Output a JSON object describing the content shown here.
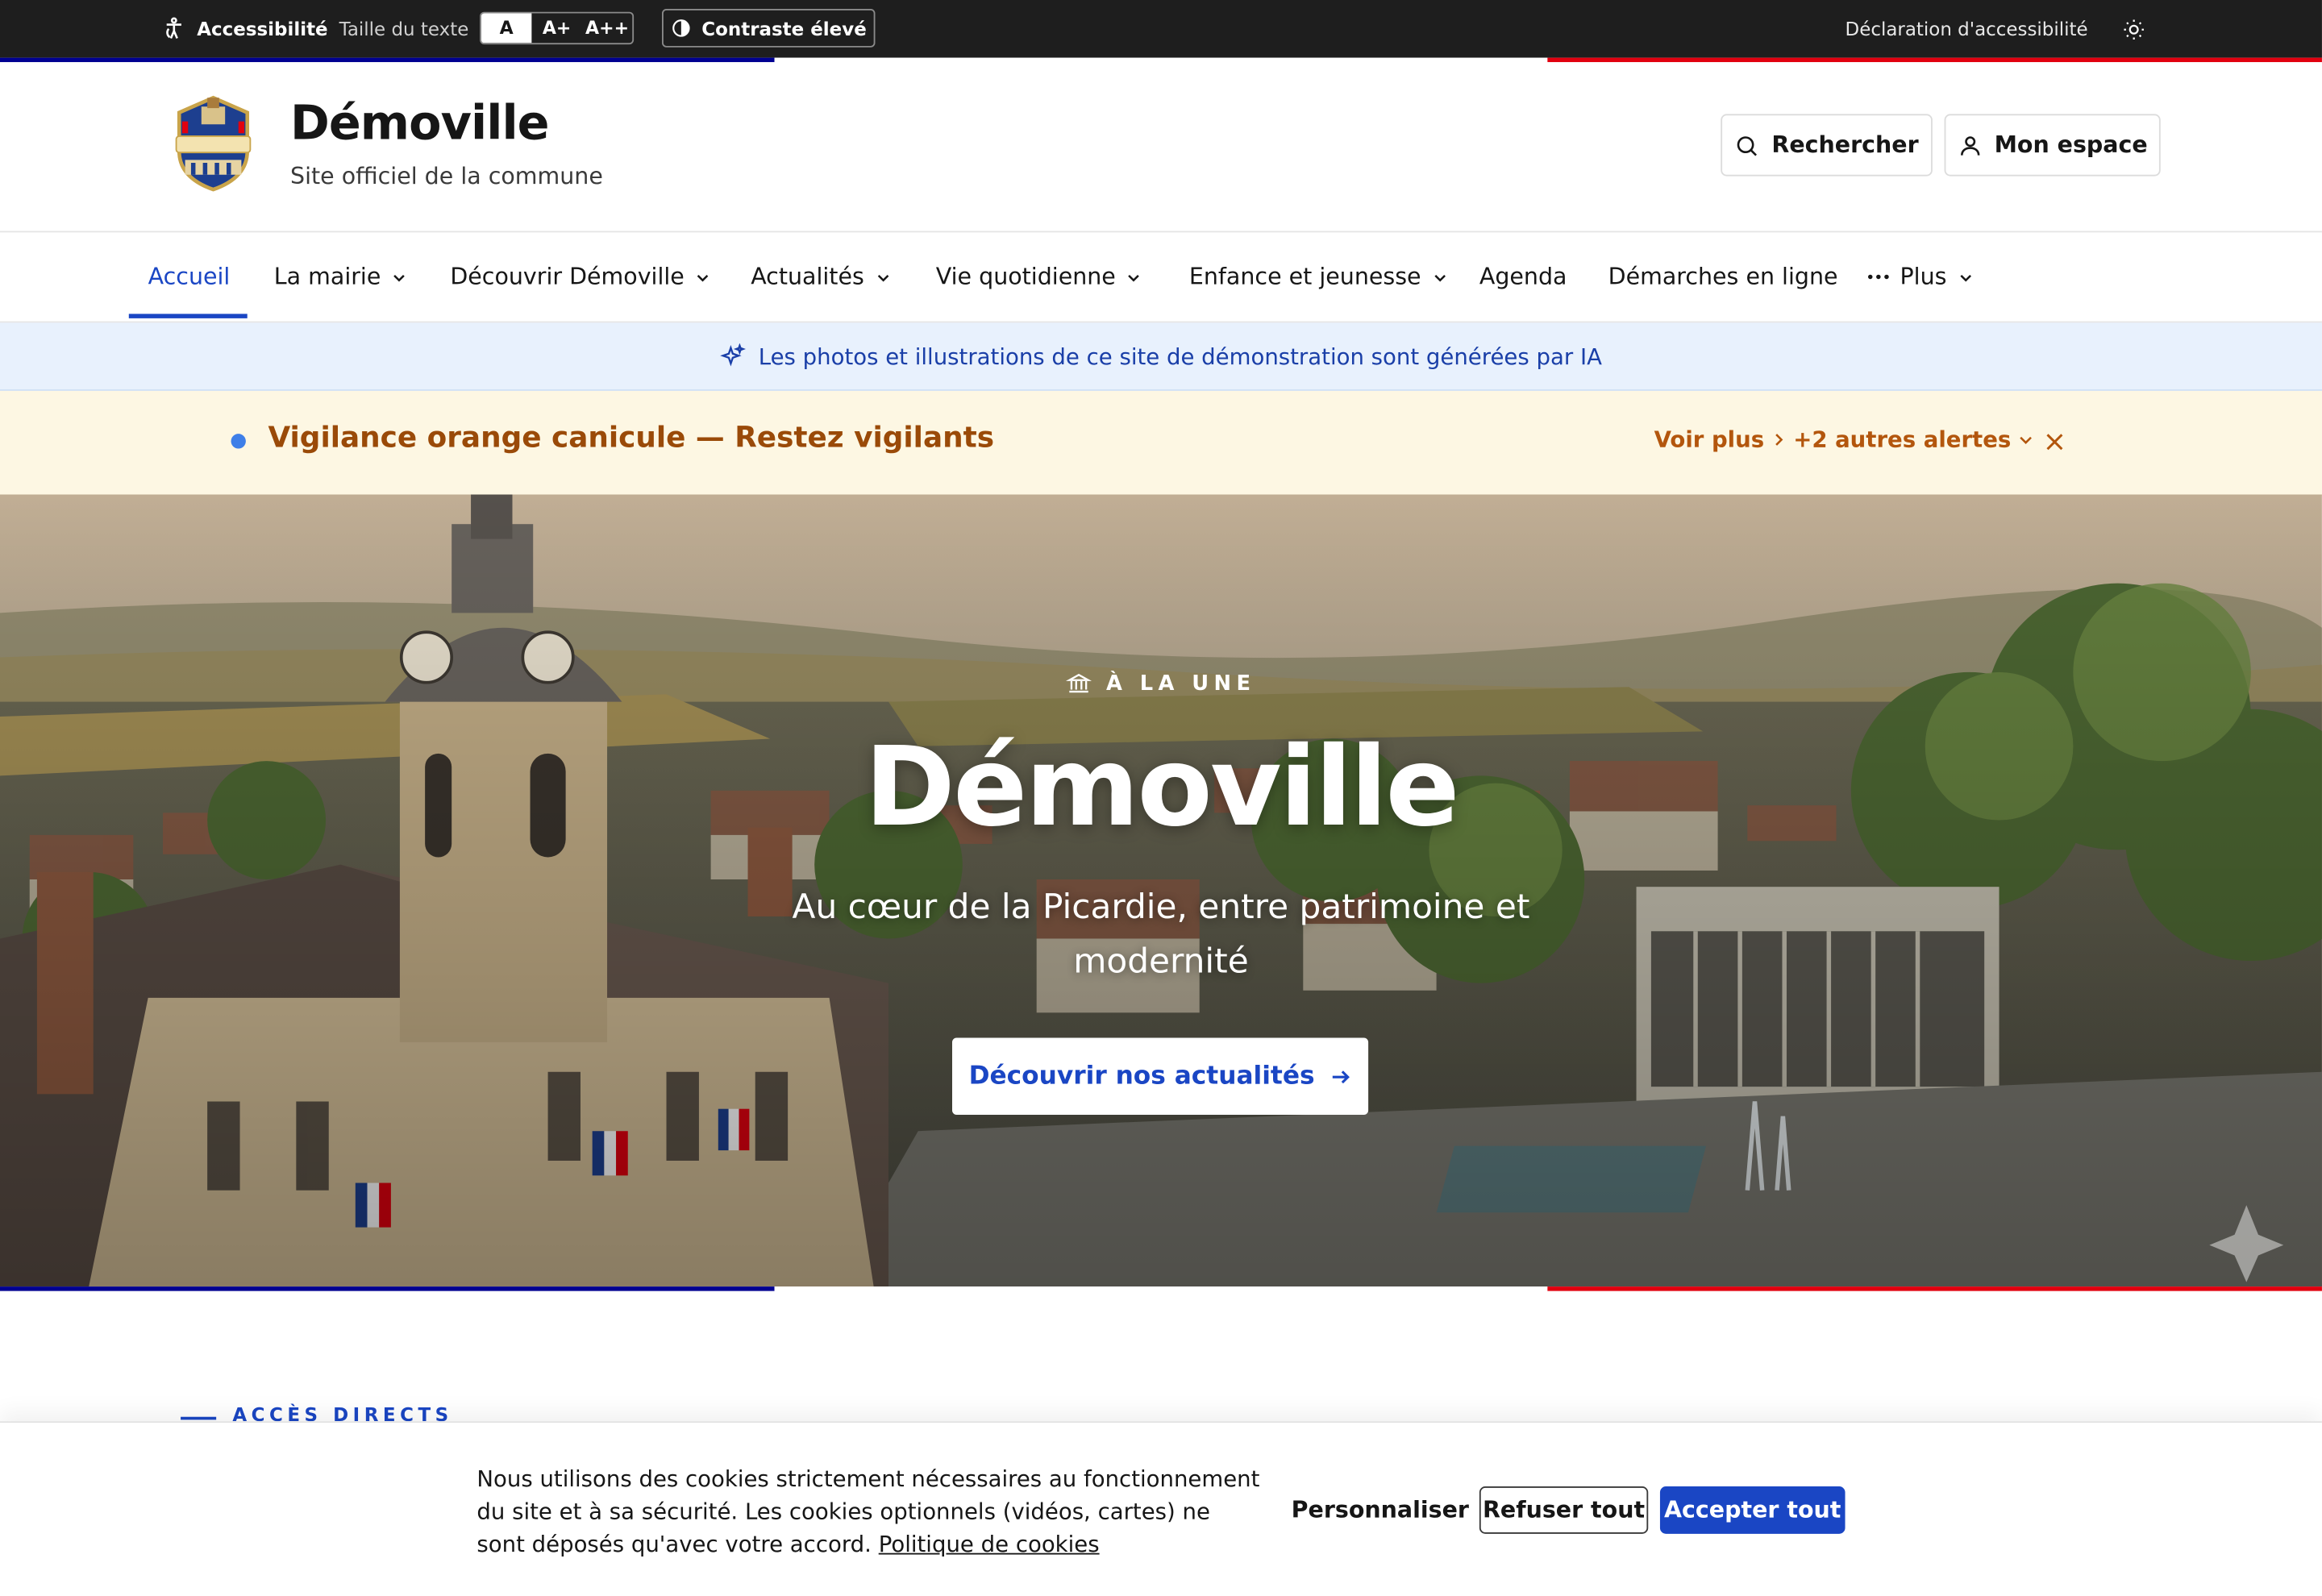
{
  "topbar": {
    "accessibility_label": "Accessibilité",
    "text_size_label": "Taille du texte",
    "sizes": [
      "A",
      "A+",
      "A++"
    ],
    "contrast_label": "Contraste élevé",
    "declaration_label": "Déclaration d'accessibilité"
  },
  "header": {
    "title": "Démoville",
    "subtitle": "Site officiel de la commune",
    "search_label": "Rechercher",
    "account_label": "Mon espace"
  },
  "nav": {
    "items": [
      {
        "label": "Accueil",
        "active": true,
        "dropdown": false
      },
      {
        "label": "La mairie",
        "dropdown": true
      },
      {
        "label": "Découvrir Démoville",
        "dropdown": true
      },
      {
        "label": "Actualités",
        "dropdown": true
      },
      {
        "label": "Vie quotidienne",
        "dropdown": true
      },
      {
        "label": "Enfance et jeunesse",
        "dropdown": true
      },
      {
        "label": "Agenda",
        "dropdown": false
      },
      {
        "label": "Démarches en ligne",
        "dropdown": false
      },
      {
        "label": "Plus",
        "dropdown": true
      }
    ]
  },
  "ai_banner": {
    "text": "Les photos et illustrations de ce site de démonstration sont générées par IA"
  },
  "alert": {
    "text": "Vigilance orange canicule — Restez vigilants",
    "more_label": "Voir plus",
    "others_label": "+2 autres alertes"
  },
  "hero": {
    "kicker": "À LA UNE",
    "title": "Démoville",
    "subtitle": "Au cœur de la Picardie, entre patrimoine et modernité",
    "cta_label": "Découvrir nos actualités"
  },
  "section": {
    "acces_label": "ACCÈS DIRECTS"
  },
  "cookie": {
    "text": "Nous utilisons des cookies strictement nécessaires au fonctionnement du site et à sa sécurité. Les cookies optionnels (vidéos, cartes) ne sont déposés qu'avec votre accord.",
    "policy_link": "Politique de cookies",
    "customize_label": "Personnaliser",
    "refuse_label": "Refuser tout",
    "accept_label": "Accepter tout"
  },
  "colors": {
    "primary_blue": "#1a46c4",
    "flag_blue": "#000091",
    "flag_red": "#e1000f",
    "alert_text": "#9a4a08",
    "topbar_bg": "#1e1e1e"
  }
}
